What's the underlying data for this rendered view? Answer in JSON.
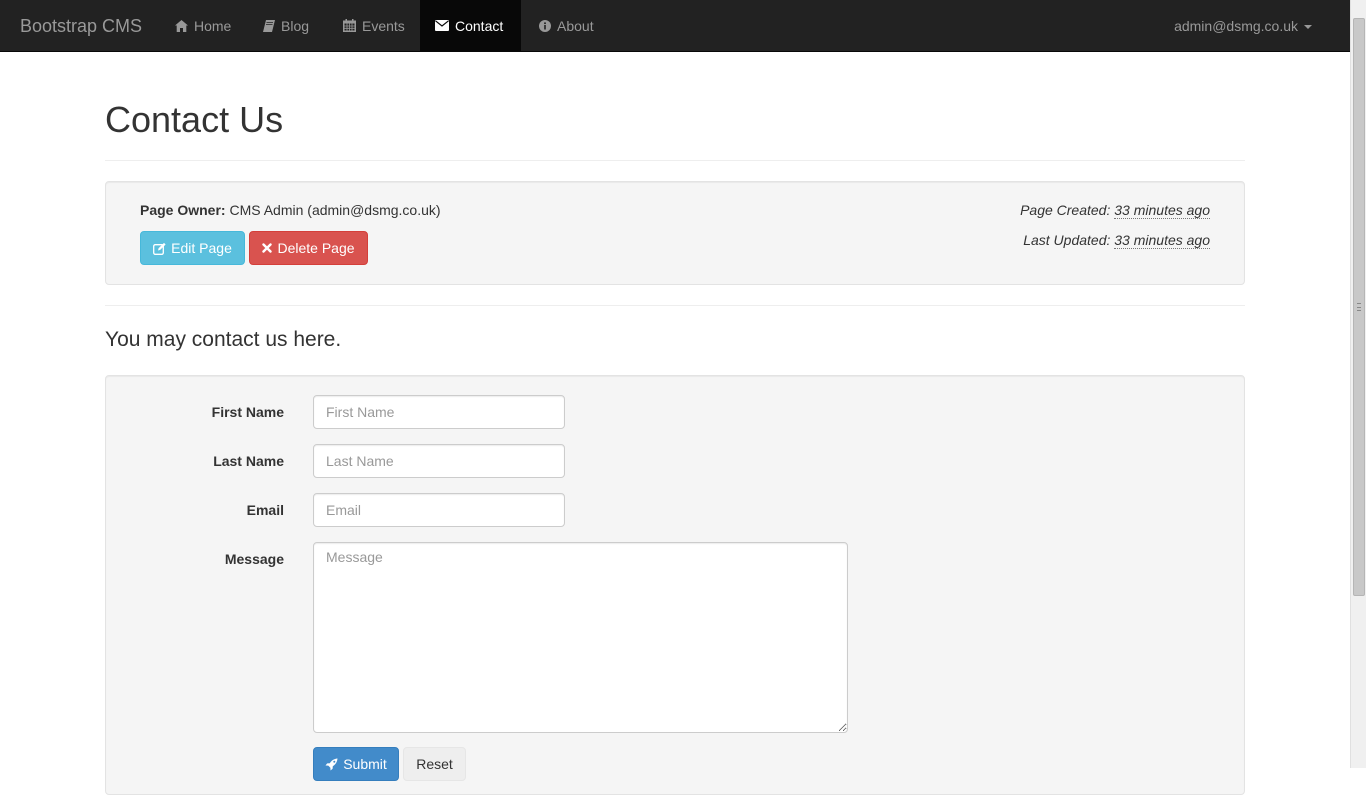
{
  "navbar": {
    "brand": "Bootstrap CMS",
    "items": [
      {
        "label": "Home",
        "icon": "home-icon"
      },
      {
        "label": "Blog",
        "icon": "book-icon"
      },
      {
        "label": "Events",
        "icon": "calendar-icon"
      },
      {
        "label": "Contact",
        "icon": "envelope-icon",
        "active": true
      },
      {
        "label": "About",
        "icon": "info-circle-icon"
      }
    ],
    "user": "admin@dsmg.co.uk"
  },
  "page": {
    "title": "Contact Us",
    "owner_label": "Page Owner:",
    "owner_value": "CMS Admin (admin@dsmg.co.uk)",
    "edit_button": "Edit Page",
    "delete_button": "Delete Page",
    "created_label": "Page Created:",
    "created_value": "33 minutes ago",
    "updated_label": "Last Updated:",
    "updated_value": "33 minutes ago",
    "intro": "You may contact us here."
  },
  "form": {
    "first_name": {
      "label": "First Name",
      "placeholder": "First Name",
      "value": ""
    },
    "last_name": {
      "label": "Last Name",
      "placeholder": "Last Name",
      "value": ""
    },
    "email": {
      "label": "Email",
      "placeholder": "Email",
      "value": ""
    },
    "message": {
      "label": "Message",
      "placeholder": "Message",
      "value": ""
    },
    "submit_button": "Submit",
    "reset_button": "Reset"
  },
  "colors": {
    "navbar_bg": "#222222",
    "info": "#5bc0de",
    "danger": "#d9534f",
    "primary": "#428bca"
  }
}
